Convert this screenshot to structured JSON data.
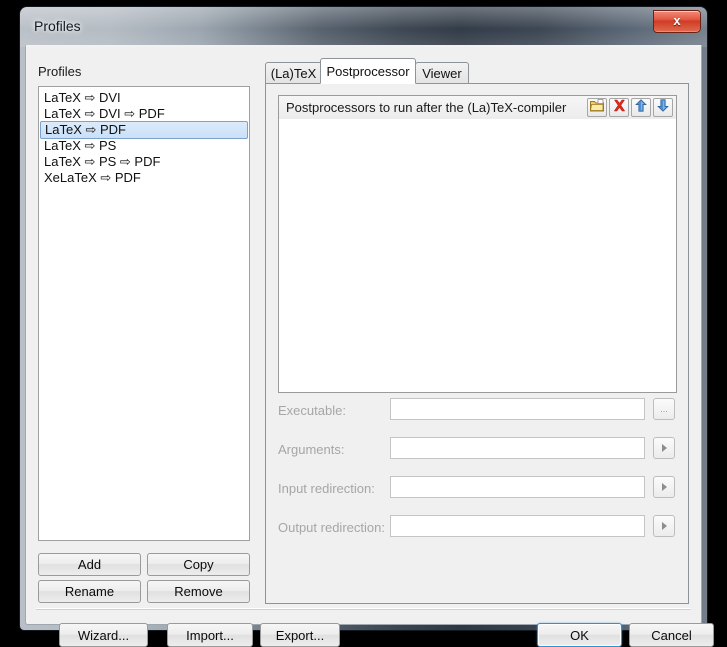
{
  "window": {
    "title": "Profiles",
    "close_label": "x",
    "close_icon": "close-icon"
  },
  "left_panel": {
    "label": "Profiles",
    "profiles": [
      {
        "label": "LaTeX ⇨ DVI",
        "selected": false
      },
      {
        "label": "LaTeX ⇨ DVI ⇨ PDF",
        "selected": false
      },
      {
        "label": "LaTeX ⇨ PDF",
        "selected": true
      },
      {
        "label": "LaTeX ⇨ PS",
        "selected": false
      },
      {
        "label": "LaTeX ⇨ PS ⇨ PDF",
        "selected": false
      },
      {
        "label": "XeLaTeX ⇨ PDF",
        "selected": false
      }
    ],
    "buttons": {
      "add": "Add",
      "copy": "Copy",
      "rename": "Rename",
      "remove": "Remove"
    }
  },
  "tabs": [
    {
      "label": "(La)TeX",
      "active": false
    },
    {
      "label": "Postprocessor",
      "active": true
    },
    {
      "label": "Viewer",
      "active": false
    }
  ],
  "group": {
    "title": "Postprocessors to run after the (La)TeX-compiler",
    "toolbar": [
      {
        "name": "new-folder-icon",
        "tooltip": "Add"
      },
      {
        "name": "delete-x-icon",
        "tooltip": "Remove"
      },
      {
        "name": "arrow-up-icon",
        "tooltip": "Move up"
      },
      {
        "name": "arrow-down-icon",
        "tooltip": "Move down"
      }
    ],
    "list_items": []
  },
  "fields": [
    {
      "label": "Executable:",
      "value": "",
      "placeholder": "",
      "side_button": "browse-ellipsis",
      "side_label": "...",
      "disabled": true
    },
    {
      "label": "Arguments:",
      "value": "",
      "placeholder": "",
      "side_button": "expand-arrow",
      "side_label": "",
      "disabled": true
    },
    {
      "label": "Input redirection:",
      "value": "",
      "placeholder": "",
      "side_button": "expand-arrow",
      "side_label": "",
      "disabled": true
    },
    {
      "label": "Output redirection:",
      "value": "",
      "placeholder": "",
      "side_button": "expand-arrow",
      "side_label": "",
      "disabled": true
    }
  ],
  "bottom_bar": {
    "wizard": "Wizard...",
    "import": "Import...",
    "export": "Export...",
    "ok": "OK",
    "cancel": "Cancel"
  },
  "colors": {
    "accent_focus": "#2c92d6",
    "selection_bg": "#c9e0f7",
    "disabled_text": "#a6a6a6",
    "close_red": "#cf3a22",
    "dialog_bg": "#f0f0f0"
  }
}
